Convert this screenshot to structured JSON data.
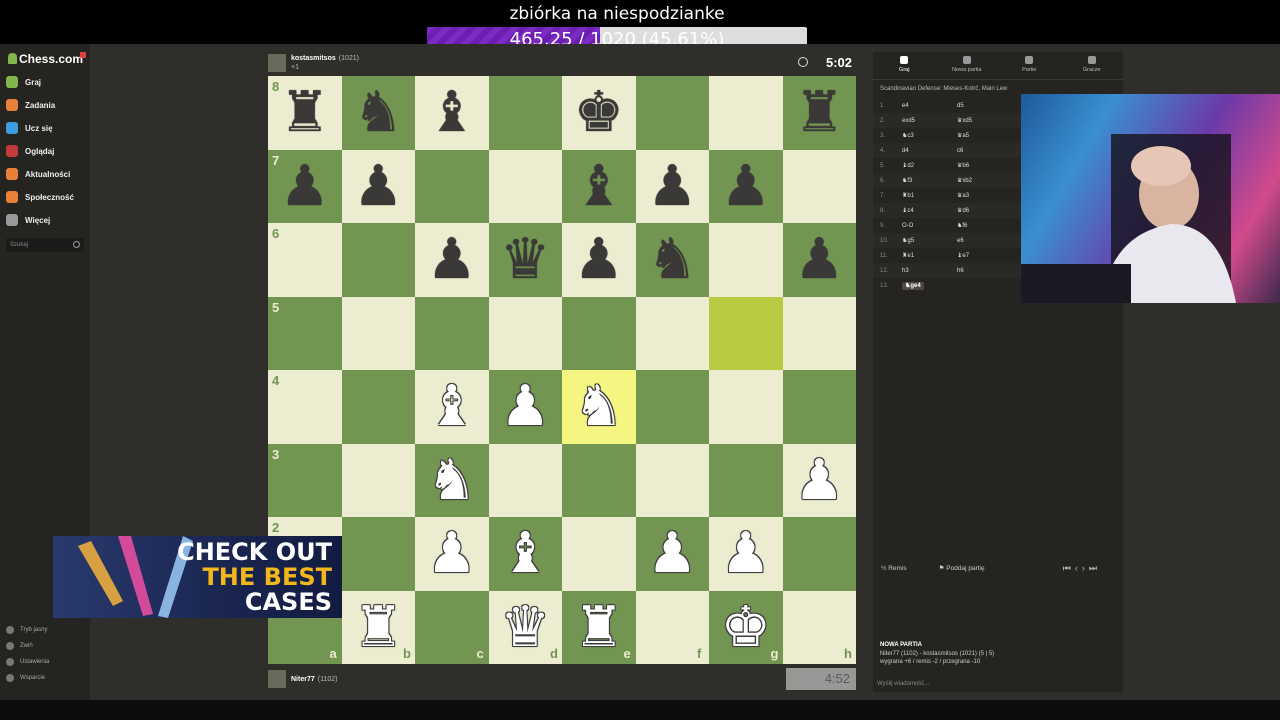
{
  "stream": {
    "goal_title": "zbiórka na niespodzianke",
    "goal_text": "465.25 / 1020 (45.61%)",
    "goal_fraction": 0.4561
  },
  "sidebar": {
    "logo": "Chess.com",
    "items": [
      {
        "label": "Graj",
        "icon": "pawn-icon",
        "color": "#81b64c"
      },
      {
        "label": "Zadania",
        "icon": "puzzle-icon",
        "color": "#e8803a"
      },
      {
        "label": "Ucz się",
        "icon": "lessons-icon",
        "color": "#3a9ee0"
      },
      {
        "label": "Oglądaj",
        "icon": "watch-icon",
        "color": "#c33a3a"
      },
      {
        "label": "Aktualności",
        "icon": "news-icon",
        "color": "#e8803a"
      },
      {
        "label": "Społeczność",
        "icon": "community-icon",
        "color": "#e8803a"
      },
      {
        "label": "Więcej",
        "icon": "more-icon",
        "color": "#999999"
      }
    ],
    "search_placeholder": "Szukaj",
    "bottom": [
      "Tryb jasny",
      "Zwiń",
      "Ustawienia",
      "Wsparcie"
    ]
  },
  "players": {
    "top": {
      "name": "kostasmitsos",
      "rating": "(1021)",
      "clock": "5:02",
      "extra": "+1"
    },
    "bottom": {
      "name": "Niter77",
      "rating": "(1102)",
      "clock": "4:52"
    }
  },
  "board": {
    "files": [
      "a",
      "b",
      "c",
      "d",
      "e",
      "f",
      "g",
      "h"
    ],
    "ranks": [
      "8",
      "7",
      "6",
      "5",
      "4",
      "3",
      "2",
      "1"
    ],
    "highlight": [
      "g5",
      "e4"
    ],
    "pieces": [
      [
        "r",
        "n",
        "b",
        "",
        "k",
        "",
        "",
        "r"
      ],
      [
        "p",
        "p",
        "",
        "",
        "b",
        "p",
        "p",
        ""
      ],
      [
        "",
        "",
        "p",
        "q",
        "p",
        "n",
        "",
        "p"
      ],
      [
        "",
        "",
        "",
        "",
        "",
        "",
        "",
        ""
      ],
      [
        "",
        "",
        "B",
        "P",
        "N",
        "",
        "",
        ""
      ],
      [
        "",
        "",
        "N",
        "",
        "",
        "",
        "",
        "P"
      ],
      [
        "",
        "",
        "P",
        "B",
        "",
        "P",
        "P",
        ""
      ],
      [
        "",
        "R",
        "",
        "Q",
        "R",
        "",
        "K",
        ""
      ]
    ]
  },
  "panel": {
    "tabs": [
      "Graj",
      "Nowa partia",
      "Partie",
      "Gracze"
    ],
    "opening": "Scandinavian Defense: Mieses-Kotrč, Main Lew",
    "moves": [
      [
        "1.",
        "e4",
        "d5"
      ],
      [
        "2.",
        "exd5",
        "♛xd5"
      ],
      [
        "3.",
        "♞c3",
        "♛a5"
      ],
      [
        "4.",
        "d4",
        "c6"
      ],
      [
        "5.",
        "♝d2",
        "♛b6"
      ],
      [
        "6.",
        "♞f3",
        "♛xb2"
      ],
      [
        "7.",
        "♜b1",
        "♛a3"
      ],
      [
        "8.",
        "♝c4",
        "♛d6"
      ],
      [
        "9.",
        "O-O",
        "♞f6"
      ],
      [
        "10.",
        "♞g5",
        "e6"
      ],
      [
        "11.",
        "♜e1",
        "♝e7"
      ],
      [
        "12.",
        "h3",
        "h6"
      ],
      [
        "13.",
        "♞ge4",
        ""
      ]
    ],
    "draw": "Remis",
    "resign": "Poddaj partię",
    "new_game_title": "NOWA PARTIA",
    "new_game_line1": "Niter77 (1102) - kostasmitsos (1021) (5 | 5)",
    "new_game_line2": "wygrana +6 / remis -2 / przegrana -10",
    "chat_placeholder": "Wyślij wiadomość..."
  },
  "ad": {
    "line1": "CHECK OUT",
    "line2": "THE BEST",
    "line3": "CASES"
  }
}
